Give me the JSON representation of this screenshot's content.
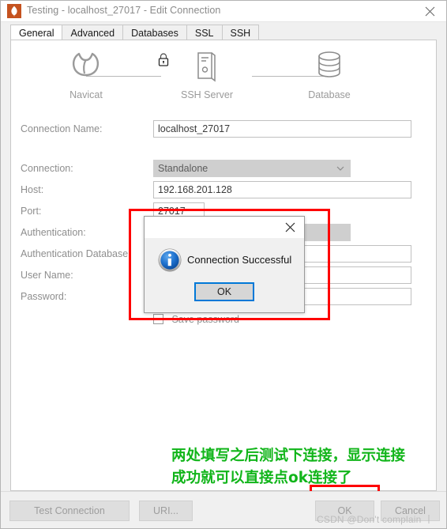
{
  "window": {
    "title": "Testing - localhost_27017 - Edit Connection",
    "app_icon": "mongodb-leaf-icon",
    "close_label": "✕",
    "icon_color": "#c5521f"
  },
  "tabs": [
    {
      "label": "General",
      "active": true
    },
    {
      "label": "Advanced",
      "active": false
    },
    {
      "label": "Databases",
      "active": false
    },
    {
      "label": "SSL",
      "active": false
    },
    {
      "label": "SSH",
      "active": false
    }
  ],
  "topology": {
    "nodes": [
      {
        "label": "Navicat",
        "icon": "navicat-logo-icon"
      },
      {
        "label": "SSH Server",
        "icon": "server-tower-icon"
      },
      {
        "label": "Database",
        "icon": "database-cylinder-icon"
      }
    ],
    "lock_icon": "padlock-icon"
  },
  "form": {
    "fields": [
      {
        "label": "Connection Name:",
        "value": "localhost_27017",
        "type": "text",
        "name": "connection-name"
      },
      {
        "label": "Connection:",
        "value": "Standalone",
        "type": "combo",
        "name": "connection-type"
      },
      {
        "label": "Host:",
        "value": "192.168.201.128",
        "type": "text",
        "name": "host"
      },
      {
        "label": "Port:",
        "value": "27017",
        "type": "text",
        "name": "port"
      },
      {
        "label": "Authentication:",
        "value": "",
        "type": "combo",
        "name": "authentication"
      },
      {
        "label": "Authentication Database",
        "value": "",
        "type": "text",
        "name": "authentication-database"
      },
      {
        "label": "User Name:",
        "value": "",
        "type": "text",
        "name": "user-name"
      },
      {
        "label": "Password:",
        "value": "",
        "type": "password",
        "name": "password"
      }
    ],
    "save_password_label": "Save password",
    "combo_arrow": "⌄"
  },
  "dialog": {
    "message": "Connection Successful",
    "ok_label": "OK",
    "close_label": "✕",
    "icon": "info-circle-icon",
    "focus_color": "#0078d7"
  },
  "annotation": {
    "line1": "两处填写之后测试下连接，显示连接",
    "line2": "成功就可以直接点ok连接了",
    "color": "#11b51a"
  },
  "highlights": {
    "color": "#fe0000",
    "regions": [
      "dialog",
      "test-connection-button",
      "ok-button"
    ]
  },
  "buttons": {
    "test_connection": "Test Connection",
    "uri": "URI...",
    "ok": "OK",
    "cancel": "Cancel"
  },
  "watermark": "CSDN @Don't complain 丨"
}
